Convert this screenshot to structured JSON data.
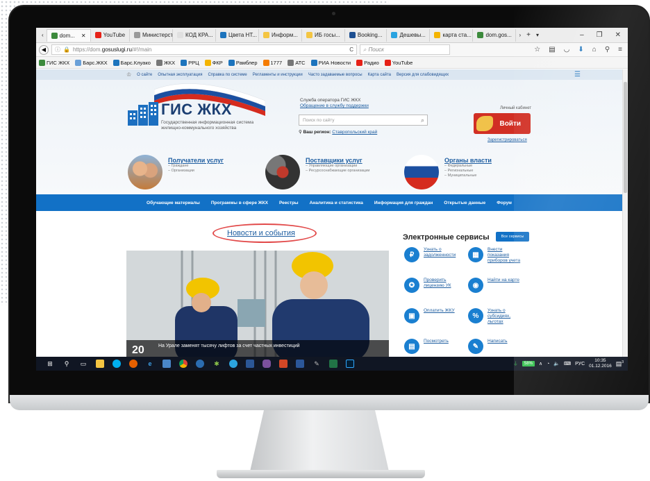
{
  "browser": {
    "tabs": [
      {
        "label": "dom...",
        "color": "#3c8a3c",
        "active": true
      },
      {
        "label": "YouTube",
        "color": "#e62117"
      },
      {
        "label": "Министерств...",
        "color": "#999999"
      },
      {
        "label": "КОД КРА...",
        "color": "#e0e0e0"
      },
      {
        "label": "Цвета НТ...",
        "color": "#1d74bd"
      },
      {
        "label": "Информ...",
        "color": "#f4c542"
      },
      {
        "label": "ИБ госы...",
        "color": "#f4c542"
      },
      {
        "label": "Booking...",
        "color": "#1d4f91"
      },
      {
        "label": "Дешевы...",
        "color": "#29a3e0"
      },
      {
        "label": "карта ста...",
        "color": "#f4b400"
      },
      {
        "label": "dom.gos...",
        "color": "#3c8a3c"
      }
    ],
    "url_scheme": "https://dom.",
    "url_host": "gosuslugi.ru",
    "url_path": "/#!/main",
    "search_placeholder": "Поиск",
    "bookmarks": [
      "ГИС ЖКХ",
      "Барс.ЖКХ",
      "Барс.Клуако",
      "ЖКХ",
      "РРЦ",
      "ФКР",
      "Рамблер",
      "1777",
      "АТС",
      "РИА Новости",
      "Радио",
      "YouTube"
    ]
  },
  "site": {
    "top_links": [
      "О сайте",
      "Опытная эксплуатация",
      "Справка по системе",
      "Регламенты и инструкции",
      "Часто задаваемые вопросы",
      "Карта сайта",
      "Версия для слабовидящих"
    ],
    "logo_title": "ГИС ЖКХ",
    "logo_sub": "Государственная информационная система жилищно-коммунального хозяйства",
    "service_operator": "Служба оператора ГИС ЖКХ",
    "support_link": "Обращение в службу поддержки",
    "search_placeholder": "Поиск по сайту",
    "region_label": "Ваш регион:",
    "region_value": "Ставропольский край",
    "cabinet_label": "Личный кабинет",
    "login_label": "Войти",
    "register_label": "Зарегистрироваться",
    "categories": [
      {
        "title": "Получатели услуг",
        "subs": [
          "– Граждане",
          "– Организации"
        ]
      },
      {
        "title": "Поставщики услуг",
        "subs": [
          "– Управляющие организации",
          "– Ресурсоснабжающие организации"
        ]
      },
      {
        "title": "Органы власти",
        "subs": [
          "– Федеральные",
          "– Региональные",
          "– Муниципальные"
        ]
      }
    ],
    "menu": [
      "Обучающие материалы",
      "Программы в сфере ЖКХ",
      "Реестры",
      "Аналитика и статистика",
      "Информация для граждан",
      "Открытые данные",
      "Форум"
    ],
    "news_heading": "Новости и события",
    "news_caption": "На Урале заменят тысячу лифтов за счет частных инвестиций",
    "news_date": "20",
    "services_heading": "Электронные сервисы",
    "services_all": "Все сервисы",
    "services": [
      {
        "label": "Узнать о задолженности",
        "icon": "ruble-icon"
      },
      {
        "label": "Внести показания приборов учета",
        "icon": "meter-icon"
      },
      {
        "label": "Проверить лицензию УК",
        "icon": "license-icon"
      },
      {
        "label": "Найти на карте",
        "icon": "map-pin-icon"
      },
      {
        "label": "Оплатить ЖКУ",
        "icon": "wallet-icon"
      },
      {
        "label": "Узнать о субсидиях, льготах",
        "icon": "percent-icon"
      },
      {
        "label": "Посмотреть",
        "icon": "doc-icon"
      },
      {
        "label": "Написать",
        "icon": "pen-icon"
      }
    ]
  },
  "taskbar": {
    "battery": "58%",
    "lang": "РУС",
    "time": "10:35",
    "date": "01.12.2016",
    "notif": "3"
  }
}
